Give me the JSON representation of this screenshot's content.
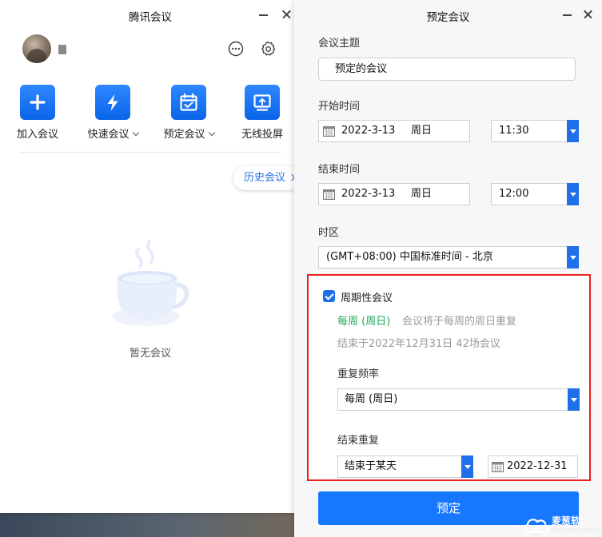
{
  "left_window": {
    "title": "腾讯会议",
    "actions": [
      {
        "label": "加入会议",
        "icon": "plus-icon"
      },
      {
        "label": "快速会议",
        "icon": "lightning-icon",
        "has_dropdown": true
      },
      {
        "label": "预定会议",
        "icon": "calendar-icon",
        "has_dropdown": true
      },
      {
        "label": "无线投屏",
        "icon": "screen-cast-icon"
      }
    ],
    "history_label": "历史会议",
    "empty_text": "暂无会议"
  },
  "right_window": {
    "title": "预定会议",
    "subject_label": "会议主题",
    "subject_value": "预定的会议",
    "start_label": "开始时间",
    "start_date": "2022-3-13",
    "start_day": "周日",
    "start_time": "11:30",
    "end_label": "结束时间",
    "end_date": "2022-3-13",
    "end_day": "周日",
    "end_time": "12:00",
    "timezone_label": "时区",
    "timezone_value": "(GMT+08:00) 中国标准时间 - 北京",
    "recurring": {
      "label": "周期性会议",
      "checked": true,
      "freq_summary": "每周 (周日)",
      "freq_desc": "会议将于每周的周日重复",
      "end_summary": "结束于2022年12月31日 42场会议",
      "freq_label": "重复频率",
      "freq_value": "每周 (周日)",
      "end_repeat_label": "结束重复",
      "end_type": "结束于某天",
      "end_date": "2022-12-31"
    },
    "schedule_button": "预定"
  },
  "watermark": {
    "text": "麦葱软",
    "url": "www.maicongruan.com"
  },
  "colors": {
    "accent": "#1677ff",
    "highlight_border": "#e8211f",
    "success_green": "#1ea85a"
  }
}
